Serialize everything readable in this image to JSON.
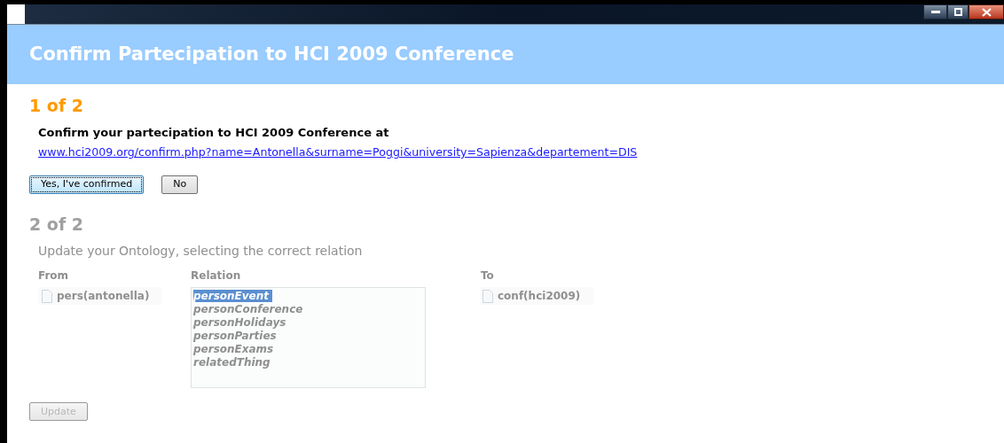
{
  "window": {
    "title": "Confirm Partecipation to HCI 2009 Conference"
  },
  "steps": [
    {
      "step": "1 of 2",
      "disabled": false,
      "prompt": "Confirm your partecipation to HCI 2009 Conference at",
      "link": "www.hci2009.org/confirm.php?name=Antonella&surname=Poggi&university=Sapienza&departement=DIS",
      "buttons": [
        {
          "label": "Yes, I've confirmed",
          "focused": true
        },
        {
          "label": "No",
          "focused": false
        }
      ]
    },
    {
      "step": "2 of 2",
      "disabled": true,
      "prompt": "Update your Ontology, selecting the correct relation",
      "from": {
        "label": "From",
        "item": "pers(antonella)"
      },
      "relation": {
        "label": "Relation",
        "options": [
          {
            "text": "personEvent",
            "selected": true
          },
          {
            "text": "personConference",
            "selected": false
          },
          {
            "text": "personHolidays",
            "selected": false
          },
          {
            "text": "personParties",
            "selected": false
          },
          {
            "text": "personExams",
            "selected": false
          },
          {
            "text": "relatedThing",
            "selected": false
          }
        ]
      },
      "to": {
        "label": "To",
        "item": "conf(hci2009)"
      },
      "buttons": [
        {
          "label": "Update",
          "focused": false
        }
      ]
    }
  ]
}
